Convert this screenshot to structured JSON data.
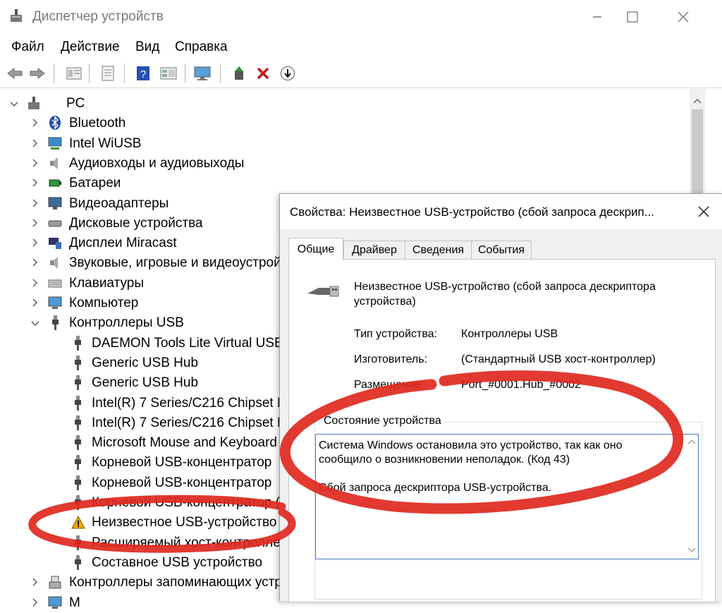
{
  "window": {
    "title": "Диспетчер устройств"
  },
  "menu": [
    "Файл",
    "Действие",
    "Вид",
    "Справка"
  ],
  "toolbar": {
    "icons": [
      "arrow-left-icon",
      "arrow-right-icon",
      "properties-icon",
      "list-icon",
      "help-icon",
      "grid-icon",
      "monitor-icon",
      "enable-device-icon",
      "delete-device-icon",
      "download-icon"
    ]
  },
  "tree": {
    "root": "PC",
    "categories": [
      "Bluetooth",
      "Intel WiUSB",
      "Аудиовходы и аудиовыходы",
      "Батареи",
      "Видеоадаптеры",
      "Дисковые устройства",
      "Дисплеи Miracast",
      "Звуковые, игровые и видеоустрой",
      "Клавиатуры",
      "Компьютер",
      "Контроллеры USB"
    ],
    "usb_children": [
      "DAEMON Tools Lite Virtual USB",
      "Generic USB Hub",
      "Generic USB Hub",
      "Intel(R) 7 Series/C216 Chipset Fa",
      "Intel(R) 7 Series/C216 Chipset Fa",
      "Microsoft Mouse and Keyboard",
      "Корневой USB-концентратор",
      "Корневой USB-концентратор",
      "Корневой USB-концентратор (",
      "Неизвестное USB-устройство (",
      "Расширяемый хост-контролле",
      "Составное USB устройство"
    ],
    "after_usb": "Контроллеры запоминающих устр",
    "partial_last": "М"
  },
  "dialog": {
    "title": "Свойства: Неизвестное USB-устройство (сбой запроса дескрип...",
    "tabs": [
      "Общие",
      "Драйвер",
      "Сведения",
      "События"
    ],
    "device_name": "Неизвестное USB-устройство (сбой запроса дескриптора устройства)",
    "props": [
      {
        "label": "Тип устройства:",
        "value": "Контроллеры USB"
      },
      {
        "label": "Изготовитель:",
        "value": "(Стандартный USB хост-контроллер)"
      },
      {
        "label": "Размещение:",
        "value": "Port_#0001.Hub_#0002"
      }
    ],
    "status_title": "Состояние устройства",
    "status_text": "Система Windows остановила это устройство, так как оно\nсообщило о возникновении неполадок. (Код 43)\n\nСбой запроса дескриптора USB-устройства."
  },
  "colors": {
    "annotation": "#e0281e",
    "accent": "#4a7cc2",
    "warning": "#f0a800"
  }
}
